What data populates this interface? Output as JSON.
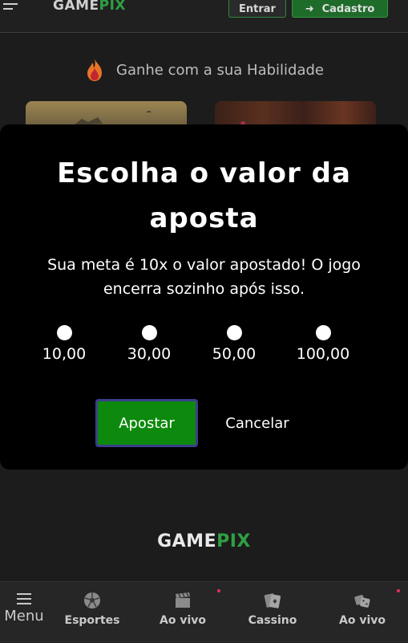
{
  "header": {
    "logo_game": "GAME",
    "logo_pix": "PIX",
    "entrar_label": "Entrar",
    "cadastro_label": "Cadastro"
  },
  "section": {
    "title": "Ganhe com a sua Habilidade"
  },
  "modal": {
    "title": "Escolha o valor da aposta",
    "message": "Sua meta é 10x o valor apostado! O jogo encerra sozinho após isso.",
    "options": [
      "10,00",
      "30,00",
      "50,00",
      "100,00"
    ],
    "confirm_label": "Apostar",
    "cancel_label": "Cancelar"
  },
  "footer": {
    "logo_game": "GAME",
    "logo_pix": "PIX"
  },
  "bottom_nav": {
    "items": [
      {
        "label": "Menu",
        "icon": "menu-icon"
      },
      {
        "label": "Esportes",
        "icon": "soccer-ball-icon"
      },
      {
        "label": "Ao vivo",
        "icon": "clapperboard-icon"
      },
      {
        "label": "Cassino",
        "icon": "cards-icon"
      },
      {
        "label": "Ao vivo",
        "icon": "dice-icon"
      }
    ]
  },
  "colors": {
    "accent_green": "#2ea043",
    "button_green": "#0d8a0d",
    "background": "#1c1c1c",
    "modal_bg": "#000000",
    "notification_dot": "#e0305a"
  }
}
